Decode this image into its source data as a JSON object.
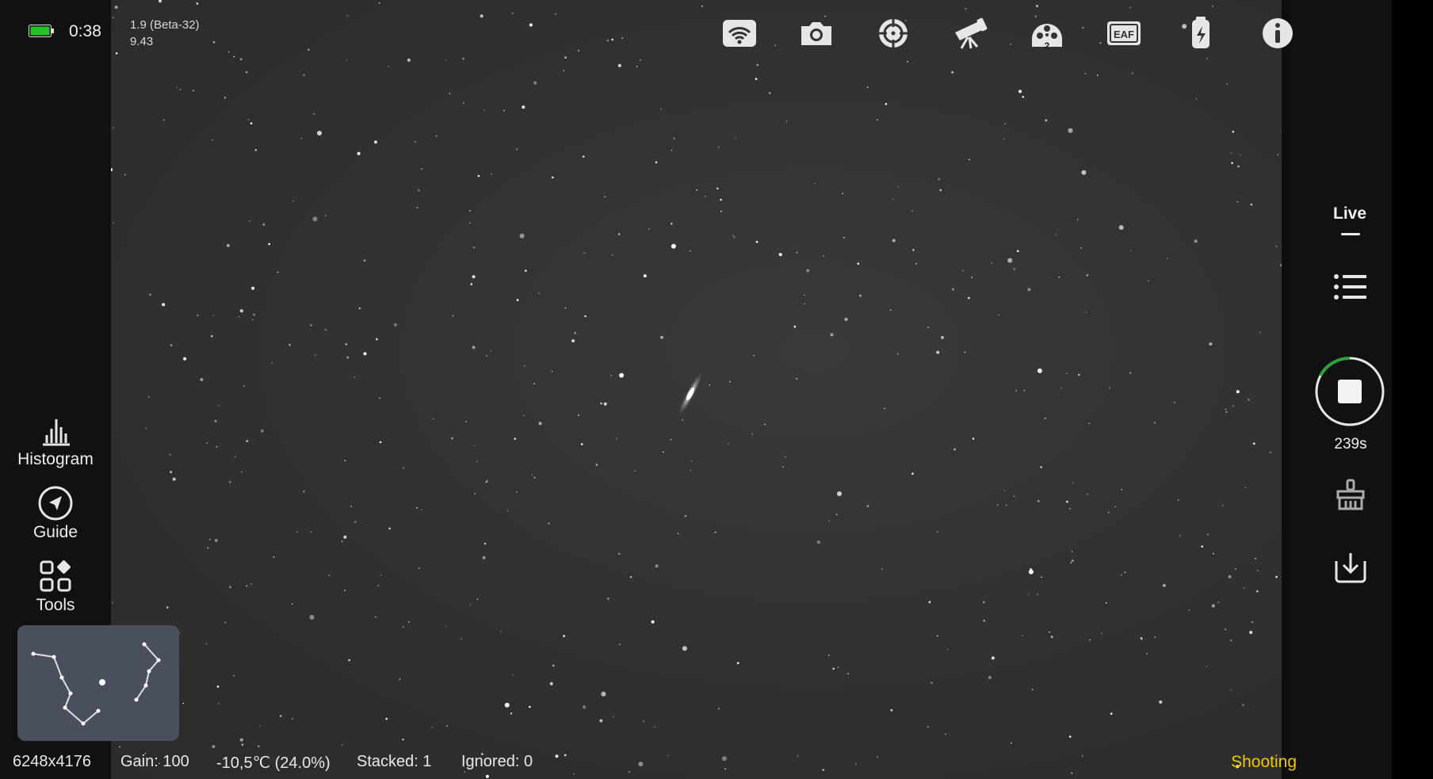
{
  "status": {
    "time": "0:38",
    "battery_color": "#22c322",
    "version": "1.9 (Beta-32)",
    "version_sub": "9.43"
  },
  "top_icons": [
    "wifi-icon",
    "camera-icon",
    "crosshair-icon",
    "telescope-icon",
    "filter-wheel-icon",
    "eaf-icon",
    "power-icon",
    "info-icon"
  ],
  "filter_wheel_badge": "2",
  "eaf_label": "EAF",
  "left_tools": {
    "histogram": "Histogram",
    "guide": "Guide",
    "tools": "Tools"
  },
  "bottom": {
    "resolution": "6248x4176",
    "gain": "Gain: 100",
    "temperature": "-10,5℃ (24.0%)",
    "stacked": "Stacked: 1",
    "ignored": "Ignored: 0",
    "state": "Shooting",
    "state_color": "#f0c800"
  },
  "right": {
    "live_label": "Live",
    "timer": "239s",
    "progress_color": "#2ea043"
  }
}
